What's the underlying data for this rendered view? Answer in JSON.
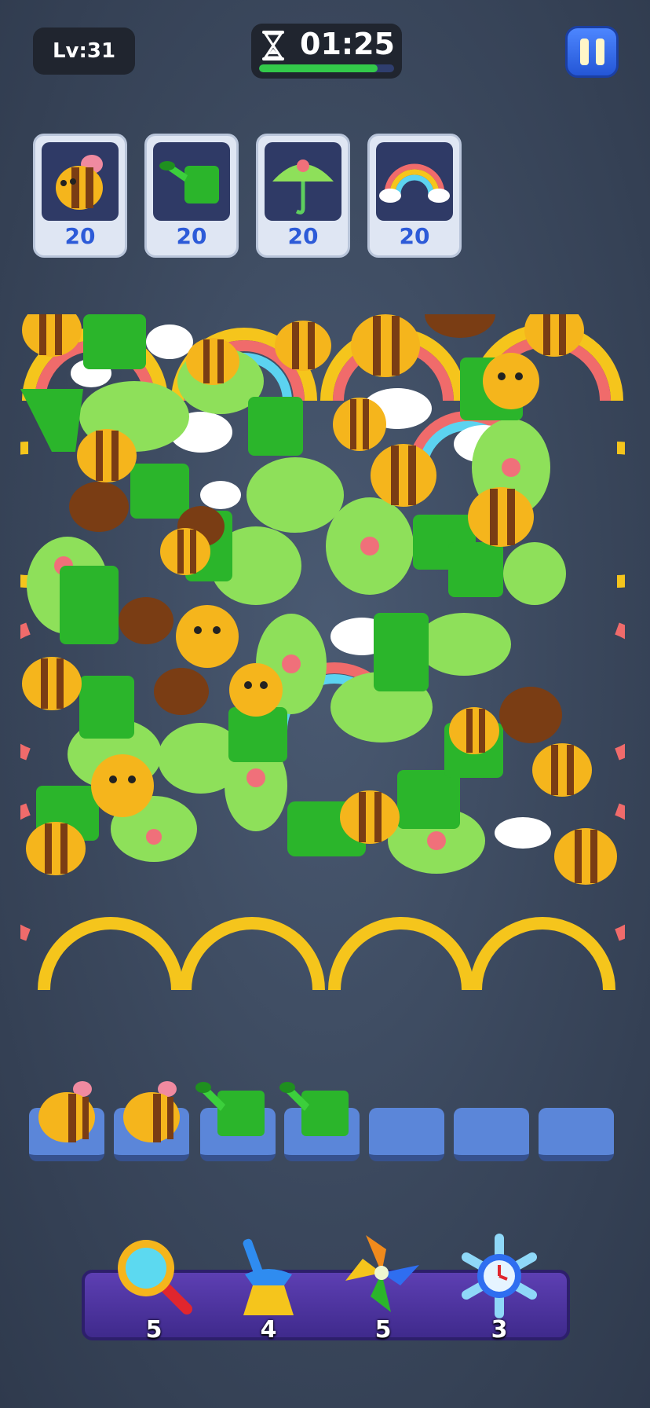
{
  "level_label": "Lv:31",
  "timer": {
    "time": "01:25",
    "progress": 0.88
  },
  "goals": [
    {
      "item": "bee",
      "count": "20"
    },
    {
      "item": "watering-can",
      "count": "20"
    },
    {
      "item": "umbrella",
      "count": "20"
    },
    {
      "item": "rainbow",
      "count": "20"
    }
  ],
  "tray_slots": [
    "bee",
    "bee",
    "watering-can",
    "watering-can",
    "",
    "",
    ""
  ],
  "powerups": [
    {
      "name": "magnifier",
      "count": "5"
    },
    {
      "name": "broom",
      "count": "4"
    },
    {
      "name": "pinwheel",
      "count": "5"
    },
    {
      "name": "freeze-clock",
      "count": "3"
    }
  ],
  "colors": {
    "accent": "#2d5bd8",
    "timer_fill": "#33c94a",
    "tray": "#5d3fb3"
  }
}
